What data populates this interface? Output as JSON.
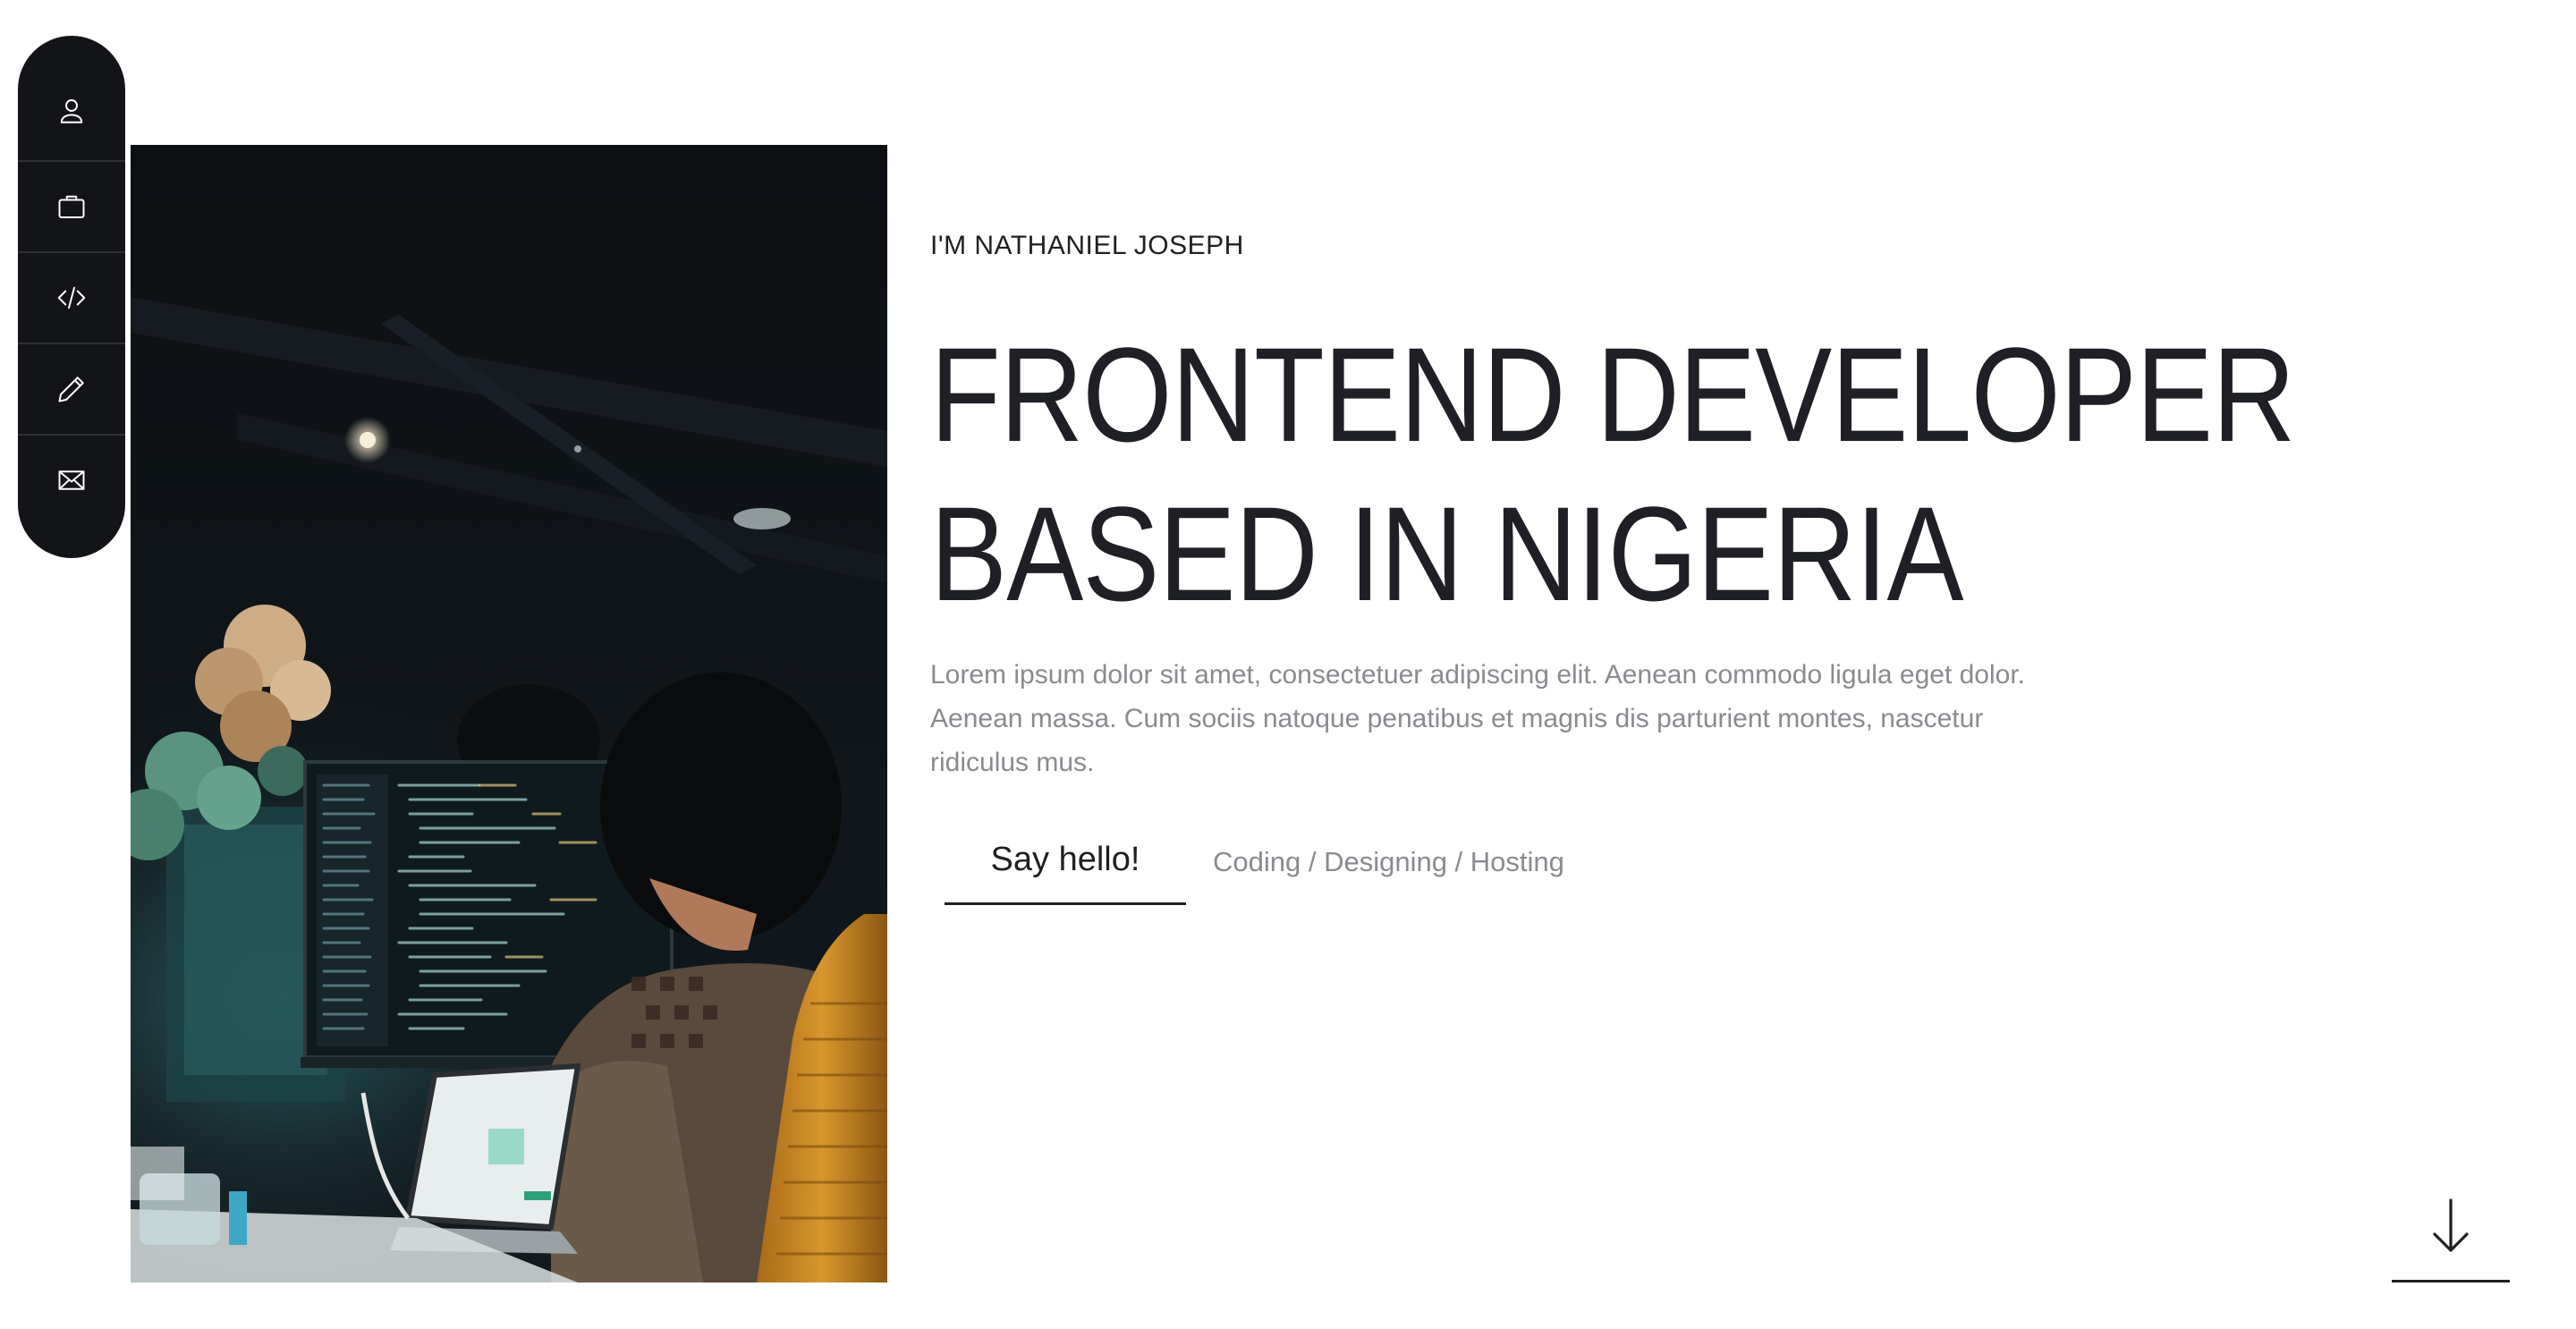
{
  "nav": {
    "items": [
      {
        "icon": "user-icon",
        "label": "About"
      },
      {
        "icon": "briefcase-icon",
        "label": "Work"
      },
      {
        "icon": "code-icon",
        "label": "Projects"
      },
      {
        "icon": "pencil-icon",
        "label": "Blog"
      },
      {
        "icon": "envelope-icon",
        "label": "Contact"
      }
    ]
  },
  "hero": {
    "eyebrow": "I'M NATHANIEL JOSEPH",
    "headline_line1": "FRONTEND DEVELOPER",
    "headline_line2": "BASED IN NIGERIA",
    "bio": "Lorem ipsum dolor sit amet, consectetuer adipiscing elit. Aenean commodo ligula eget dolor. Aenean massa. Cum sociis natoque penatibus et magnis dis parturient montes, nascetur ridiculus mus.",
    "cta_label": "Say hello!",
    "tags": "Coding / Designing / Hosting",
    "photo": "developer-at-desk-photo"
  },
  "scroll": {
    "icon": "arrow-down-icon"
  },
  "colors": {
    "sidebar_bg": "#131417",
    "text_dark": "#1f2023",
    "text_muted": "#8a8a90",
    "background": "#ffffff"
  }
}
